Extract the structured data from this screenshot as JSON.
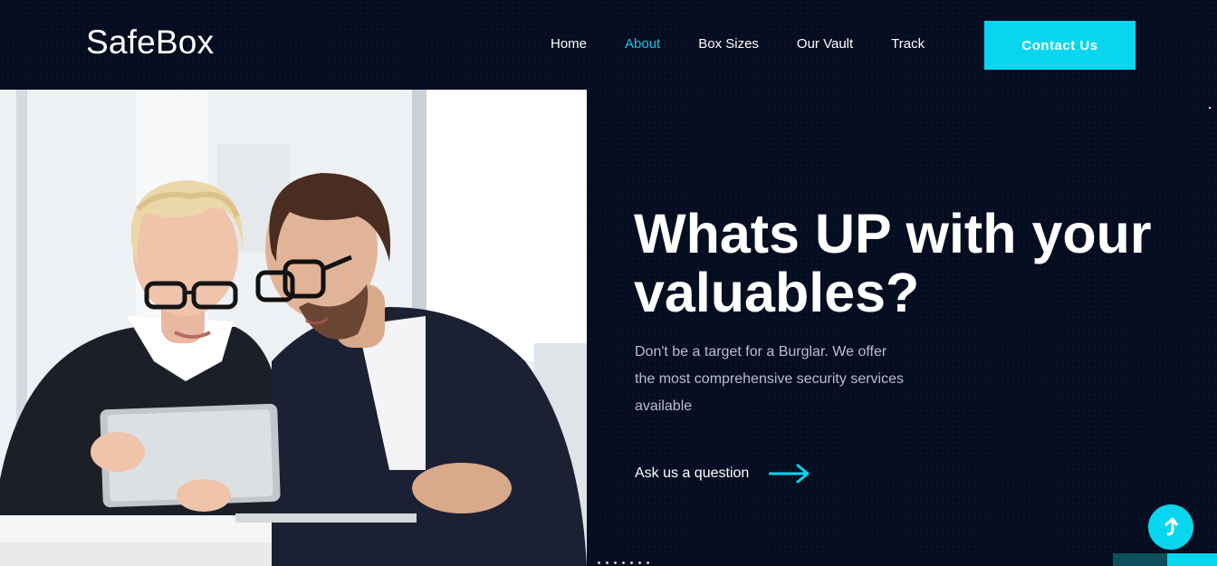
{
  "brand": {
    "logo_text": "SafeBox"
  },
  "nav": {
    "items": [
      {
        "label": "Home",
        "active": false
      },
      {
        "label": "About",
        "active": true
      },
      {
        "label": "Box Sizes",
        "active": false
      },
      {
        "label": "Our Vault",
        "active": false
      },
      {
        "label": "Track",
        "active": false
      }
    ],
    "contact_label": "Contact Us"
  },
  "hero": {
    "title_line1": "Whats UP with your",
    "title_line2": "valuables?",
    "description": "Don't be a target for a Burglar. We offer the most comprehensive security services available",
    "cta_label": "Ask us a question"
  },
  "icons": {
    "cta_arrow": "arrow-right-icon",
    "scroll_top": "arrow-up-icon"
  },
  "colors": {
    "accent": "#07d6ee",
    "background": "#050d20",
    "nav_active": "#1ac3e2"
  }
}
